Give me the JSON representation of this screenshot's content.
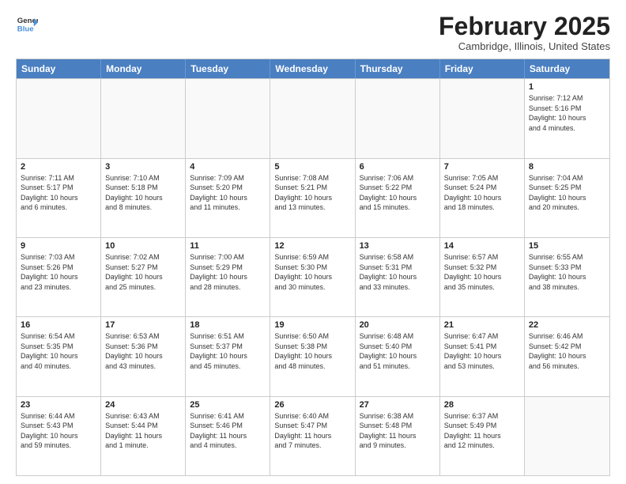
{
  "header": {
    "logo_general": "General",
    "logo_blue": "Blue",
    "month_title": "February 2025",
    "location": "Cambridge, Illinois, United States"
  },
  "weekdays": [
    "Sunday",
    "Monday",
    "Tuesday",
    "Wednesday",
    "Thursday",
    "Friday",
    "Saturday"
  ],
  "rows": [
    [
      {
        "day": "",
        "info": ""
      },
      {
        "day": "",
        "info": ""
      },
      {
        "day": "",
        "info": ""
      },
      {
        "day": "",
        "info": ""
      },
      {
        "day": "",
        "info": ""
      },
      {
        "day": "",
        "info": ""
      },
      {
        "day": "1",
        "info": "Sunrise: 7:12 AM\nSunset: 5:16 PM\nDaylight: 10 hours\nand 4 minutes."
      }
    ],
    [
      {
        "day": "2",
        "info": "Sunrise: 7:11 AM\nSunset: 5:17 PM\nDaylight: 10 hours\nand 6 minutes."
      },
      {
        "day": "3",
        "info": "Sunrise: 7:10 AM\nSunset: 5:18 PM\nDaylight: 10 hours\nand 8 minutes."
      },
      {
        "day": "4",
        "info": "Sunrise: 7:09 AM\nSunset: 5:20 PM\nDaylight: 10 hours\nand 11 minutes."
      },
      {
        "day": "5",
        "info": "Sunrise: 7:08 AM\nSunset: 5:21 PM\nDaylight: 10 hours\nand 13 minutes."
      },
      {
        "day": "6",
        "info": "Sunrise: 7:06 AM\nSunset: 5:22 PM\nDaylight: 10 hours\nand 15 minutes."
      },
      {
        "day": "7",
        "info": "Sunrise: 7:05 AM\nSunset: 5:24 PM\nDaylight: 10 hours\nand 18 minutes."
      },
      {
        "day": "8",
        "info": "Sunrise: 7:04 AM\nSunset: 5:25 PM\nDaylight: 10 hours\nand 20 minutes."
      }
    ],
    [
      {
        "day": "9",
        "info": "Sunrise: 7:03 AM\nSunset: 5:26 PM\nDaylight: 10 hours\nand 23 minutes."
      },
      {
        "day": "10",
        "info": "Sunrise: 7:02 AM\nSunset: 5:27 PM\nDaylight: 10 hours\nand 25 minutes."
      },
      {
        "day": "11",
        "info": "Sunrise: 7:00 AM\nSunset: 5:29 PM\nDaylight: 10 hours\nand 28 minutes."
      },
      {
        "day": "12",
        "info": "Sunrise: 6:59 AM\nSunset: 5:30 PM\nDaylight: 10 hours\nand 30 minutes."
      },
      {
        "day": "13",
        "info": "Sunrise: 6:58 AM\nSunset: 5:31 PM\nDaylight: 10 hours\nand 33 minutes."
      },
      {
        "day": "14",
        "info": "Sunrise: 6:57 AM\nSunset: 5:32 PM\nDaylight: 10 hours\nand 35 minutes."
      },
      {
        "day": "15",
        "info": "Sunrise: 6:55 AM\nSunset: 5:33 PM\nDaylight: 10 hours\nand 38 minutes."
      }
    ],
    [
      {
        "day": "16",
        "info": "Sunrise: 6:54 AM\nSunset: 5:35 PM\nDaylight: 10 hours\nand 40 minutes."
      },
      {
        "day": "17",
        "info": "Sunrise: 6:53 AM\nSunset: 5:36 PM\nDaylight: 10 hours\nand 43 minutes."
      },
      {
        "day": "18",
        "info": "Sunrise: 6:51 AM\nSunset: 5:37 PM\nDaylight: 10 hours\nand 45 minutes."
      },
      {
        "day": "19",
        "info": "Sunrise: 6:50 AM\nSunset: 5:38 PM\nDaylight: 10 hours\nand 48 minutes."
      },
      {
        "day": "20",
        "info": "Sunrise: 6:48 AM\nSunset: 5:40 PM\nDaylight: 10 hours\nand 51 minutes."
      },
      {
        "day": "21",
        "info": "Sunrise: 6:47 AM\nSunset: 5:41 PM\nDaylight: 10 hours\nand 53 minutes."
      },
      {
        "day": "22",
        "info": "Sunrise: 6:46 AM\nSunset: 5:42 PM\nDaylight: 10 hours\nand 56 minutes."
      }
    ],
    [
      {
        "day": "23",
        "info": "Sunrise: 6:44 AM\nSunset: 5:43 PM\nDaylight: 10 hours\nand 59 minutes."
      },
      {
        "day": "24",
        "info": "Sunrise: 6:43 AM\nSunset: 5:44 PM\nDaylight: 11 hours\nand 1 minute."
      },
      {
        "day": "25",
        "info": "Sunrise: 6:41 AM\nSunset: 5:46 PM\nDaylight: 11 hours\nand 4 minutes."
      },
      {
        "day": "26",
        "info": "Sunrise: 6:40 AM\nSunset: 5:47 PM\nDaylight: 11 hours\nand 7 minutes."
      },
      {
        "day": "27",
        "info": "Sunrise: 6:38 AM\nSunset: 5:48 PM\nDaylight: 11 hours\nand 9 minutes."
      },
      {
        "day": "28",
        "info": "Sunrise: 6:37 AM\nSunset: 5:49 PM\nDaylight: 11 hours\nand 12 minutes."
      },
      {
        "day": "",
        "info": ""
      }
    ]
  ]
}
